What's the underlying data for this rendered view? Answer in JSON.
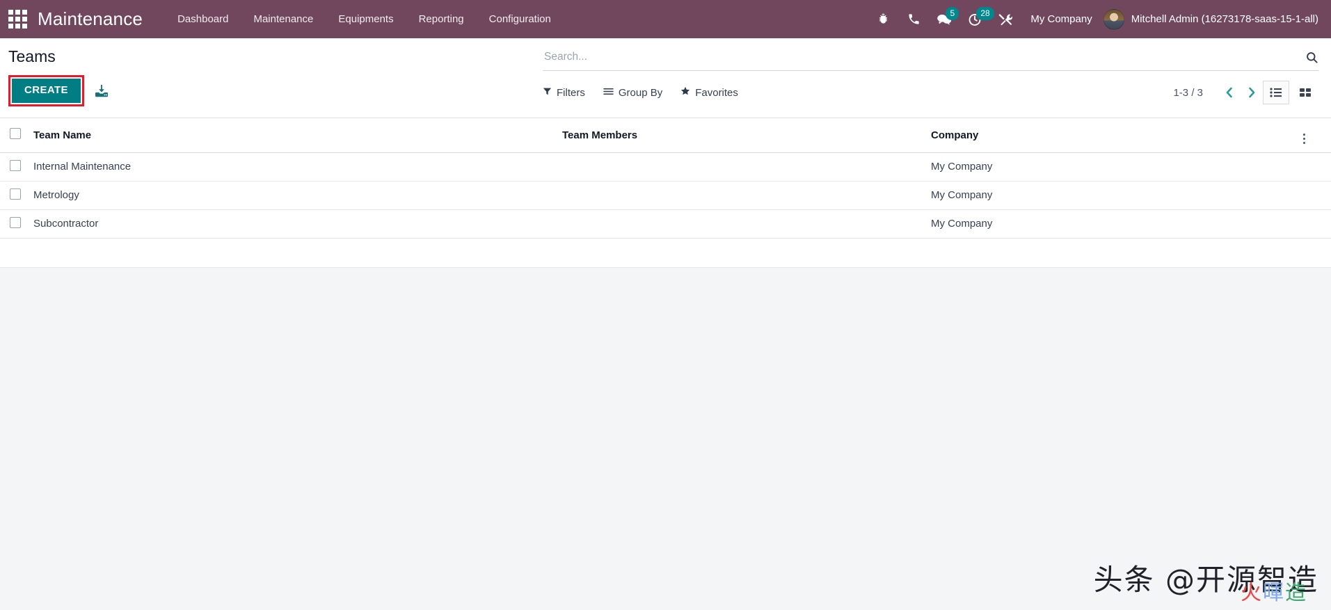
{
  "navbar": {
    "apps_icon": "apps-grid-icon",
    "brand": "Maintenance",
    "menu": [
      {
        "label": "Dashboard"
      },
      {
        "label": "Maintenance"
      },
      {
        "label": "Equipments"
      },
      {
        "label": "Reporting"
      },
      {
        "label": "Configuration"
      }
    ],
    "sys_icons": [
      {
        "name": "bug-icon",
        "badge": ""
      },
      {
        "name": "phone-icon",
        "badge": ""
      },
      {
        "name": "messages-icon",
        "badge": "5"
      },
      {
        "name": "activities-clock-icon",
        "badge": "28"
      },
      {
        "name": "tools-icon",
        "badge": ""
      }
    ],
    "company": "My Company",
    "user": "Mitchell Admin (16273178-saas-15-1-all)",
    "bg_color": "#71475e",
    "badge_color": "#00888f"
  },
  "control_panel": {
    "title": "Teams",
    "create_label": "CREATE",
    "create_color": "#017e84",
    "highlight_color": "#e8192c",
    "import_icon": "import-download-icon",
    "search": {
      "placeholder": "Search...",
      "value": "",
      "icon": "search-icon"
    },
    "filters_label": "Filters",
    "group_by_label": "Group By",
    "favorites_label": "Favorites",
    "pager": "1-3 / 3",
    "prev_icon": "chevron-left-icon",
    "next_icon": "chevron-right-icon",
    "view_list_icon": "list-view-icon",
    "view_kanban_icon": "kanban-view-icon",
    "active_view": "list"
  },
  "list": {
    "columns": [
      "Team Name",
      "Team Members",
      "Company"
    ],
    "options_icon": "column-options-icon",
    "rows": [
      {
        "name": "Internal Maintenance",
        "members": "",
        "company": "My Company"
      },
      {
        "name": "Metrology",
        "members": "",
        "company": "My Company"
      },
      {
        "name": "Subcontractor",
        "members": "",
        "company": "My Company"
      }
    ]
  },
  "watermark": {
    "text": "头条 @开源智造",
    "overlay": [
      "火",
      "暉",
      "造"
    ]
  }
}
